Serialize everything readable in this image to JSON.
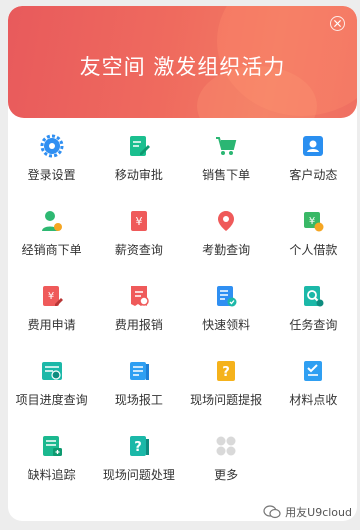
{
  "banner": {
    "title": "友空间  激发组织活力"
  },
  "apps": [
    {
      "label": "登录设置",
      "icon": "gear-icon",
      "color": "#2f8ff2"
    },
    {
      "label": "移动审批",
      "icon": "approval-pen-icon",
      "color": "#1bbf8f"
    },
    {
      "label": "销售下单",
      "icon": "cart-icon",
      "color": "#2bb673"
    },
    {
      "label": "客户动态",
      "icon": "customer-card-icon",
      "color": "#2a8ff0"
    },
    {
      "label": "经销商下单",
      "icon": "dealer-person-icon",
      "color": "#2eb872"
    },
    {
      "label": "薪资查询",
      "icon": "salary-icon",
      "color": "#ef5a5a"
    },
    {
      "label": "考勤查询",
      "icon": "location-pin-icon",
      "color": "#ef5a5a"
    },
    {
      "label": "个人借款",
      "icon": "loan-icon",
      "color": "#39b866"
    },
    {
      "label": "费用申请",
      "icon": "expense-apply-icon",
      "color": "#ef5a5a"
    },
    {
      "label": "费用报销",
      "icon": "reimburse-icon",
      "color": "#ef5a5a"
    },
    {
      "label": "快速领料",
      "icon": "material-check-icon",
      "color": "#2f8ff2"
    },
    {
      "label": "任务查询",
      "icon": "task-search-icon",
      "color": "#1bb8a8"
    },
    {
      "label": "项目进度查询",
      "icon": "project-progress-icon",
      "color": "#1bb8a8"
    },
    {
      "label": "现场报工",
      "icon": "work-report-icon",
      "color": "#2f9ff2"
    },
    {
      "label": "现场问题提报",
      "icon": "question-report-icon",
      "color": "#f5b21b"
    },
    {
      "label": "材料点收",
      "icon": "material-receive-icon",
      "color": "#2f9ff2"
    },
    {
      "label": "缺料追踪",
      "icon": "shortage-track-icon",
      "color": "#1bb88f"
    },
    {
      "label": "现场问题处理",
      "icon": "question-handle-icon",
      "color": "#1bb8a8"
    },
    {
      "label": "更多",
      "icon": "more-grid-icon",
      "color": "#d9d9d9"
    }
  ],
  "watermark": {
    "text": "用友U9cloud"
  }
}
